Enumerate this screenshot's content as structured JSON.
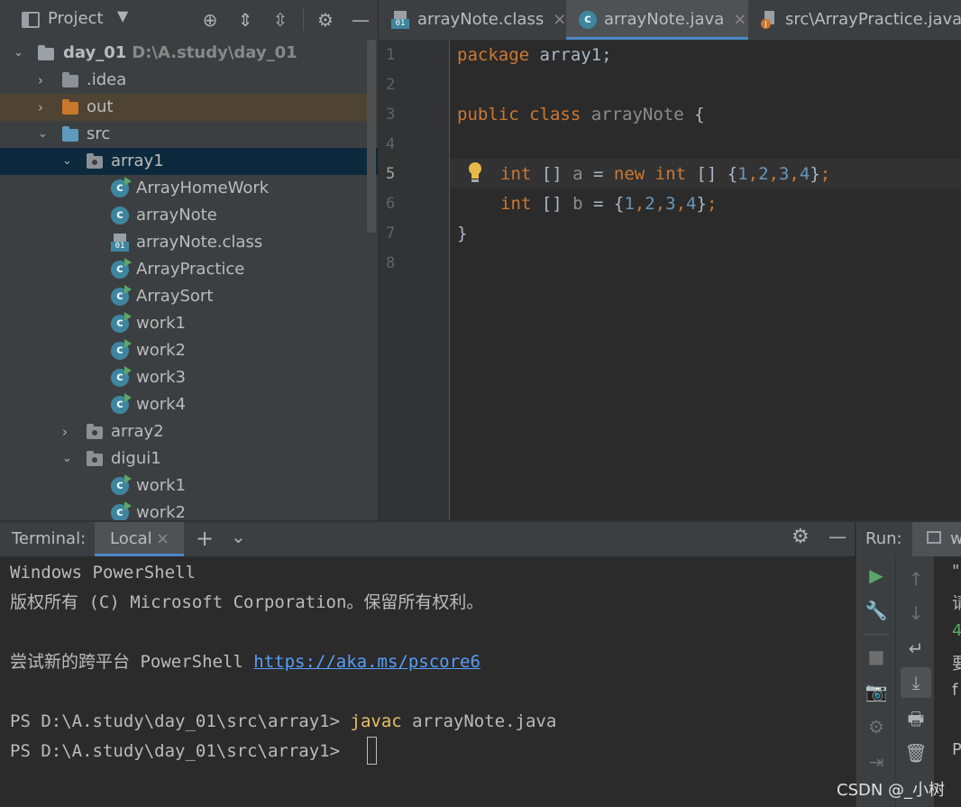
{
  "project_panel": {
    "title": "Project",
    "tree": [
      {
        "label": "day_01",
        "path": "D:\\A.study\\day_01",
        "type": "module",
        "expanded": true
      },
      {
        "label": ".idea",
        "type": "folder",
        "expanded": false
      },
      {
        "label": "out",
        "type": "folder-excluded",
        "expanded": false
      },
      {
        "label": "src",
        "type": "folder-source",
        "expanded": true
      },
      {
        "label": "array1",
        "type": "package",
        "expanded": true,
        "selected": true
      },
      {
        "label": "ArrayHomeWork",
        "type": "class-runnable"
      },
      {
        "label": "arrayNote",
        "type": "class"
      },
      {
        "label": "arrayNote.class",
        "type": "class-file"
      },
      {
        "label": "ArrayPractice",
        "type": "class-runnable"
      },
      {
        "label": "ArraySort",
        "type": "class-runnable"
      },
      {
        "label": "work1",
        "type": "class-runnable"
      },
      {
        "label": "work2",
        "type": "class-runnable"
      },
      {
        "label": "work3",
        "type": "class-runnable"
      },
      {
        "label": "work4",
        "type": "class-runnable"
      },
      {
        "label": "array2",
        "type": "package",
        "expanded": false
      },
      {
        "label": "digui1",
        "type": "package",
        "expanded": true
      },
      {
        "label": "work1",
        "type": "class-runnable"
      },
      {
        "label": "work2",
        "type": "class-runnable"
      }
    ]
  },
  "editor": {
    "tabs": [
      {
        "label": "arrayNote.class",
        "active": false
      },
      {
        "label": "arrayNote.java",
        "active": true
      },
      {
        "label": "src\\ArrayPractice.java",
        "active": false
      }
    ],
    "line_numbers": [
      "1",
      "2",
      "3",
      "4",
      "5",
      "6",
      "7",
      "8"
    ],
    "code": {
      "l1_kw": "package",
      "l1_rest": " array1;",
      "l3_kw": "public class",
      "l3_name": " arrayNote",
      "l3_rest": " {",
      "l5_t1": "int",
      "l5_t2": " [] ",
      "l5_t3": "a",
      "l5_t4": " = ",
      "l5_t5": "new int",
      "l5_t6": " [] {",
      "l5_n1": "1",
      "l5_n2": "2",
      "l5_n3": "3",
      "l5_n4": "4",
      "l5_end": "};",
      "l6_t1": "int",
      "l6_t2": " [] ",
      "l6_t3": "b",
      "l6_t4": " = {",
      "l6_n1": "1",
      "l6_n2": "2",
      "l6_n3": "3",
      "l6_n4": "4",
      "l6_end": "};",
      "l7": "}",
      "comma": ",",
      "semicolon": ";"
    }
  },
  "terminal": {
    "title": "Terminal:",
    "tab": "Local",
    "lines": {
      "l1": "Windows PowerShell",
      "l2": "版权所有 (C) Microsoft Corporation。保留所有权利。",
      "l3_text": "尝试新的跨平台 PowerShell ",
      "l3_link": "https://aka.ms/pscore6",
      "l4_prompt": "PS D:\\A.study\\day_01\\src\\array1> ",
      "l4_cmd": "javac",
      "l4_args": " arrayNote.java",
      "l5_prompt": "PS D:\\A.study\\day_01\\src\\array1> "
    }
  },
  "run_panel": {
    "title": "Run:",
    "tab_partial": "w",
    "output_partial": [
      "\"",
      "请",
      "4",
      "要",
      "f",
      "",
      "P"
    ]
  },
  "watermark": "CSDN @_小树",
  "colors": {
    "keyword": "#cc7832",
    "number": "#6897bb",
    "link": "#589df6",
    "selection": "#0d293e",
    "accent": "#4a88c7"
  }
}
